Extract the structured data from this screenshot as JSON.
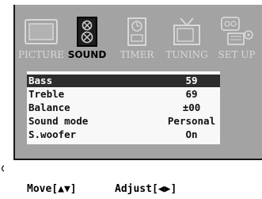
{
  "tabs": [
    {
      "id": "picture",
      "label": "PICTURE",
      "icon": "tv-icon",
      "active": false
    },
    {
      "id": "sound",
      "label": "SOUND",
      "icon": "speaker-icon",
      "active": true
    },
    {
      "id": "timer",
      "label": "TIMER",
      "icon": "timer-icon",
      "active": false
    },
    {
      "id": "tuning",
      "label": "TUNING",
      "icon": "antenna-tv-icon",
      "active": false
    },
    {
      "id": "setup",
      "label": "SET UP",
      "icon": "setup-devices-icon",
      "active": false
    }
  ],
  "settings": [
    {
      "label": "Bass",
      "value": "59",
      "selected": true
    },
    {
      "label": "Treble",
      "value": "69",
      "selected": false
    },
    {
      "label": "Balance",
      "value": "±00",
      "selected": false
    },
    {
      "label": "Sound mode",
      "value": "Personal",
      "selected": false
    },
    {
      "label": "S.woofer",
      "value": "On",
      "selected": false
    }
  ],
  "hints": {
    "move": "Move[▲▼]",
    "adjust": "Adjust[◀▶]"
  },
  "colors": {
    "frame_bg": "#a3a3a3",
    "panel_bg": "#f8f8f8",
    "selected_row": "#2d2d2d",
    "inactive_tab_text": "#d8d8d8"
  }
}
